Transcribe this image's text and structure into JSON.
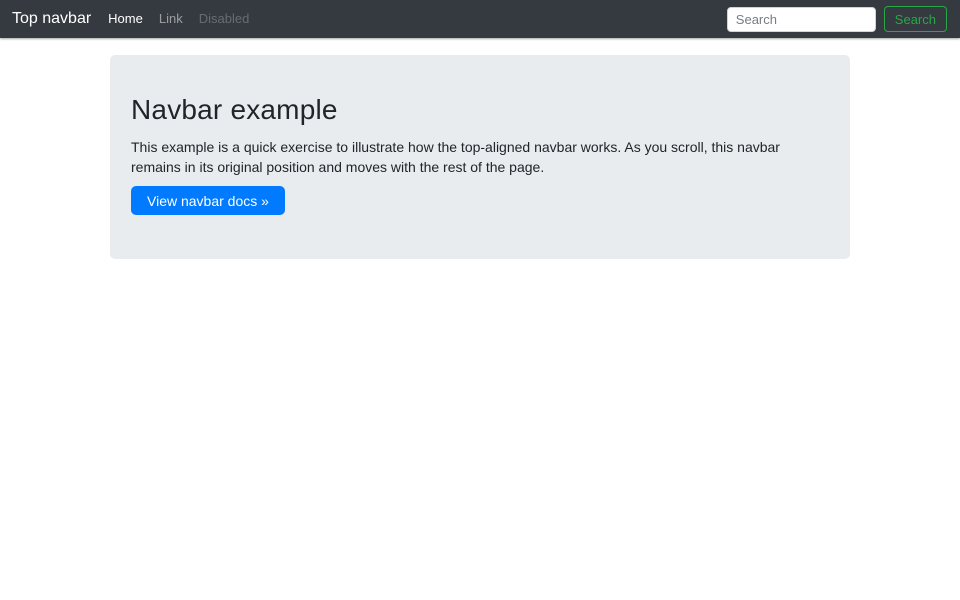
{
  "navbar": {
    "brand": "Top navbar",
    "items": [
      {
        "label": "Home",
        "state": "active"
      },
      {
        "label": "Link",
        "state": "normal"
      },
      {
        "label": "Disabled",
        "state": "disabled"
      }
    ],
    "search": {
      "placeholder": "Search",
      "button_label": "Search"
    }
  },
  "jumbotron": {
    "title": "Navbar example",
    "body": "This example is a quick exercise to illustrate how the top-aligned navbar works. As you scroll, this navbar remains in its original position and moves with the rest of the page.",
    "cta_label": "View navbar docs »"
  },
  "colors": {
    "navbar_bg": "#343a40",
    "jumbotron_bg": "#e9ecef",
    "primary": "#007bff",
    "success": "#28a745"
  }
}
